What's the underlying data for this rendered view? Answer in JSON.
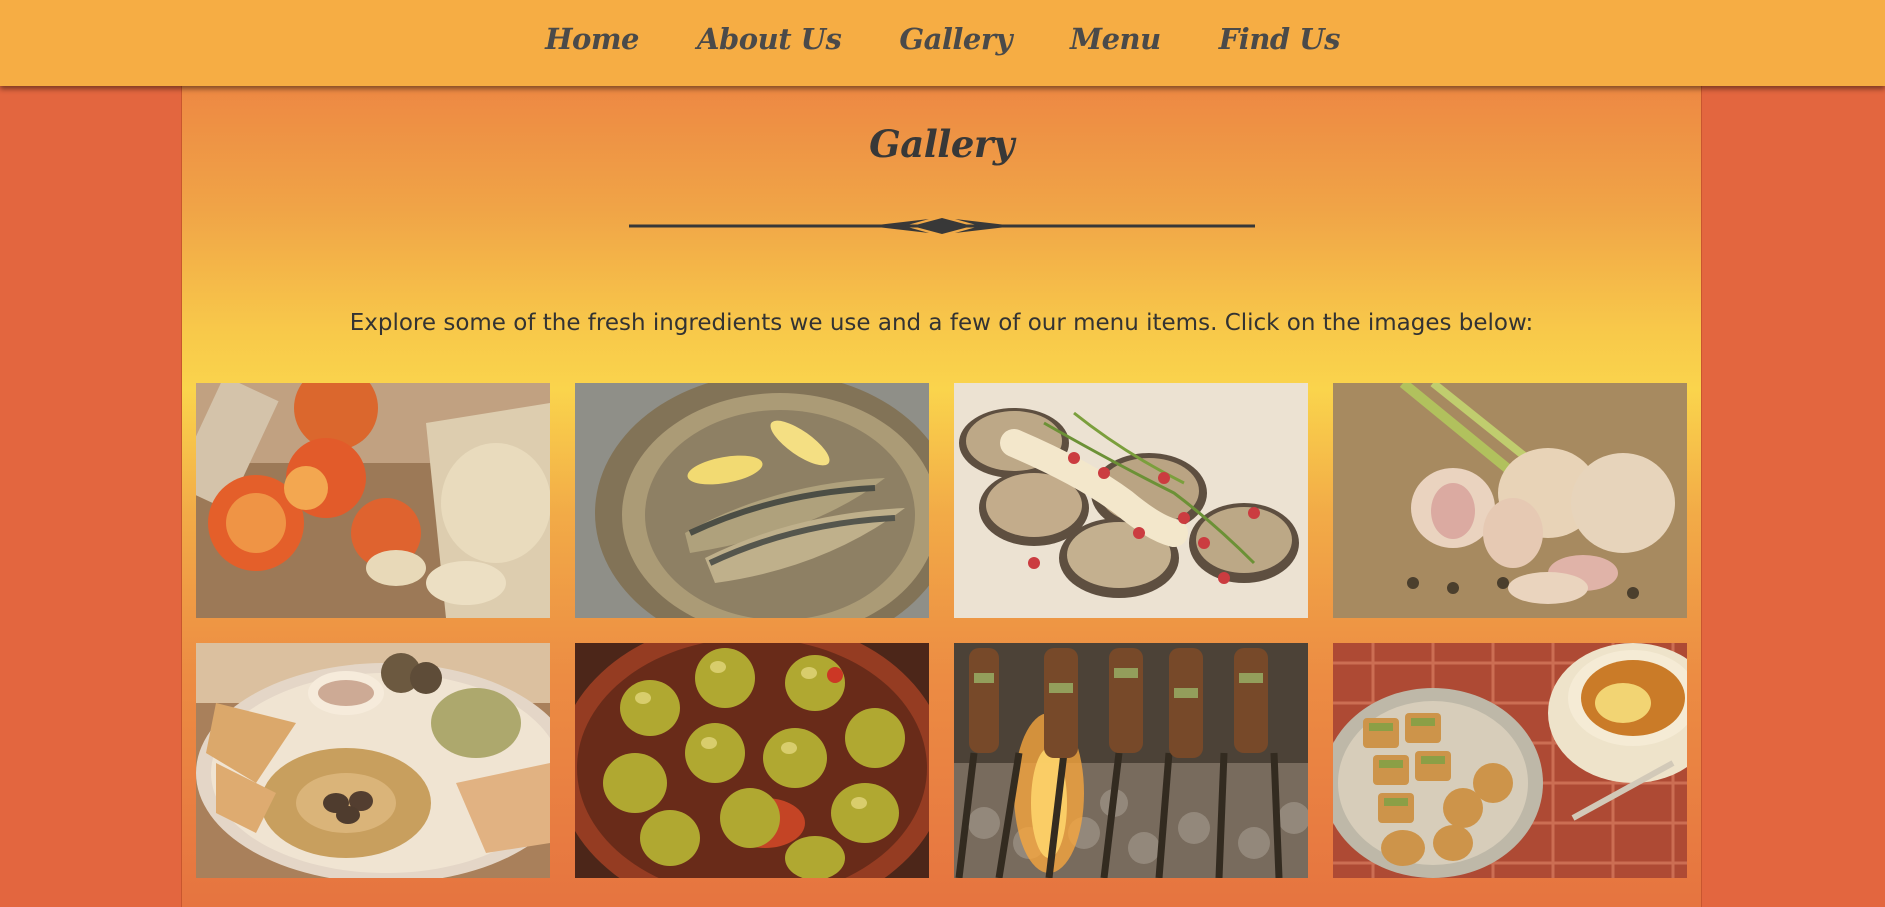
{
  "nav": {
    "items": [
      {
        "label": "Home"
      },
      {
        "label": "About Us"
      },
      {
        "label": "Gallery"
      },
      {
        "label": "Menu"
      },
      {
        "label": "Find Us"
      }
    ]
  },
  "page": {
    "title": "Gallery",
    "intro": "Explore some of the fresh ingredients we use and a few of our menu items. Click on the images below:"
  },
  "gallery": {
    "images": [
      {
        "subject": "tomatoes-and-onions"
      },
      {
        "subject": "sardines-on-plate"
      },
      {
        "subject": "eggplant-with-pomegranate"
      },
      {
        "subject": "garlic-bulbs"
      },
      {
        "subject": "hummus-platter"
      },
      {
        "subject": "green-olives"
      },
      {
        "subject": "grilled-skewers"
      },
      {
        "subject": "baklava-and-tea"
      }
    ]
  },
  "colors": {
    "background": "#e3663f",
    "navbar": "#f6ad44",
    "text": "#383838"
  }
}
